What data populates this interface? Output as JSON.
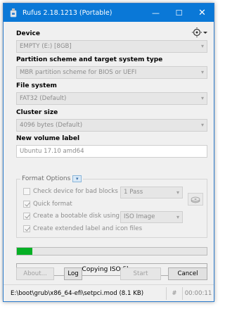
{
  "window": {
    "title": "Rufus 2.18.1213 (Portable)"
  },
  "titlebar": {
    "minimize": "—",
    "maximize": "☐",
    "close": "✕"
  },
  "device": {
    "label": "Device",
    "value": "EMPTY (E:) [8GB]"
  },
  "partition": {
    "label": "Partition scheme and target system type",
    "value": "MBR partition scheme for BIOS or UEFI"
  },
  "filesystem": {
    "label": "File system",
    "value": "FAT32 (Default)"
  },
  "cluster": {
    "label": "Cluster size",
    "value": "4096 bytes (Default)"
  },
  "volume": {
    "label": "New volume label",
    "value": "Ubuntu 17.10 amd64"
  },
  "format_options": {
    "legend": "Format Options",
    "bad_blocks": {
      "label": "Check device for bad blocks",
      "checked": false,
      "passes": "1 Pass"
    },
    "quick_format": {
      "label": "Quick format",
      "checked": true
    },
    "bootable": {
      "label": "Create a bootable disk using",
      "checked": true,
      "source": "ISO Image"
    },
    "extended": {
      "label": "Create extended label and icon files",
      "checked": true
    }
  },
  "progress": {
    "percent": 8
  },
  "status": {
    "text": "Copying ISO files..."
  },
  "buttons": {
    "about": "About...",
    "log": "Log",
    "start": "Start",
    "cancel": "Cancel"
  },
  "statusbar": {
    "path": "E:\\boot\\grub\\x86_64-efi\\setpci.mod (8.1 KB)",
    "hash": "#",
    "time": "00:00:11"
  },
  "colors": {
    "titlebar": "#0a78d7",
    "progress": "#06b025",
    "window_bg": "#f0f0f0"
  },
  "icons": {
    "app": "usb-drive-icon",
    "settings": "settings-dropdown-icon",
    "disk": "disk-image-icon"
  }
}
